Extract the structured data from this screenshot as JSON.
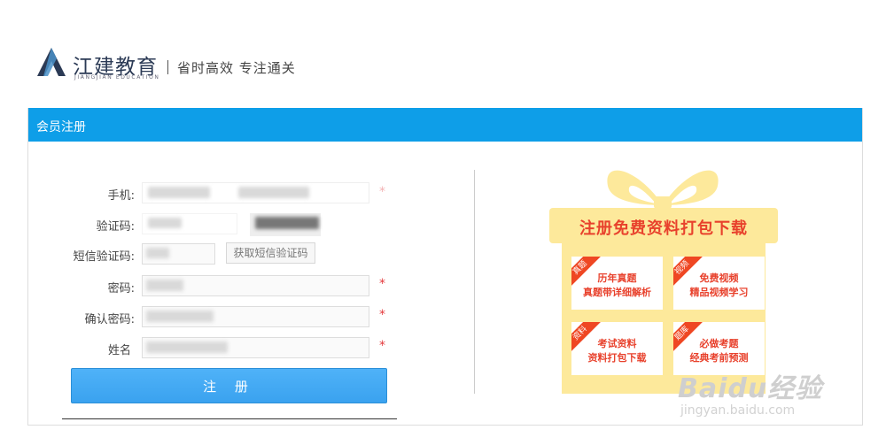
{
  "header": {
    "brand_name": "江建教育",
    "brand_subtitle": "JIANGJIAN EDUCATION",
    "slogan": "省时高效 专注通关"
  },
  "panel": {
    "title": "会员注册"
  },
  "form": {
    "phone_label": "手机:",
    "code_label": "验证码:",
    "sms_code_label": "短信验证码:",
    "sms_button": "获取短信验证码",
    "password_label": "密码:",
    "confirm_password_label": "确认密码:",
    "name_label": "姓名",
    "required_mark": "*",
    "submit_label": "注 册"
  },
  "promo": {
    "title": "注册免费资料打包下载",
    "cards": [
      {
        "tag": "真题",
        "line1": "历年真题",
        "line2": "真题带详细解析"
      },
      {
        "tag": "视频",
        "line1": "免费视频",
        "line2": "精品视频学习"
      },
      {
        "tag": "资料",
        "line1": "考试资料",
        "line2": "资料打包下载"
      },
      {
        "tag": "题库",
        "line1": "必做考题",
        "line2": "经典考前预测"
      }
    ]
  },
  "watermark": {
    "brand": "Baidu经验",
    "url": "jingyan.baidu.com"
  },
  "colors": {
    "accent": "#0e9ee8",
    "button": "#3aa2ef",
    "required": "#e4393c",
    "gift": "#fde99b",
    "promo_red": "#e8412c"
  }
}
